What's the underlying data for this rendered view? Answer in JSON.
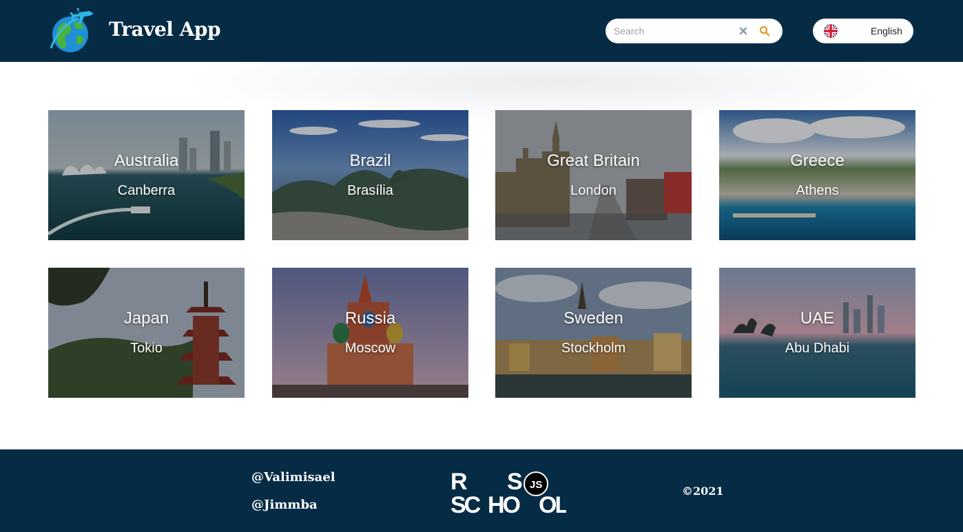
{
  "header": {
    "app_title": "Travel App",
    "search": {
      "placeholder": "Search",
      "value": ""
    },
    "language": {
      "label": "English",
      "flag_icon": "uk-flag-icon"
    }
  },
  "icons": {
    "logo": "globe-airplane-icon",
    "clear": "close-icon",
    "search": "search-icon"
  },
  "colors": {
    "header_bg": "#062b45",
    "search_icon": "#e8952c",
    "clear_icon": "#8a99a6"
  },
  "cards": [
    {
      "country": "Australia",
      "capital": "Canberra"
    },
    {
      "country": "Brazil",
      "capital": "Brasília"
    },
    {
      "country": "Great Britain",
      "capital": "London"
    },
    {
      "country": "Greece",
      "capital": "Athens"
    },
    {
      "country": "Japan",
      "capital": "Tokio"
    },
    {
      "country": "Russia",
      "capital": "Moscow"
    },
    {
      "country": "Sweden",
      "capital": "Stockholm"
    },
    {
      "country": "UAE",
      "capital": "Abu Dhabi"
    }
  ],
  "footer": {
    "authors": [
      "@Valimisael",
      "@Jimmba"
    ],
    "copyright": "©2021"
  }
}
